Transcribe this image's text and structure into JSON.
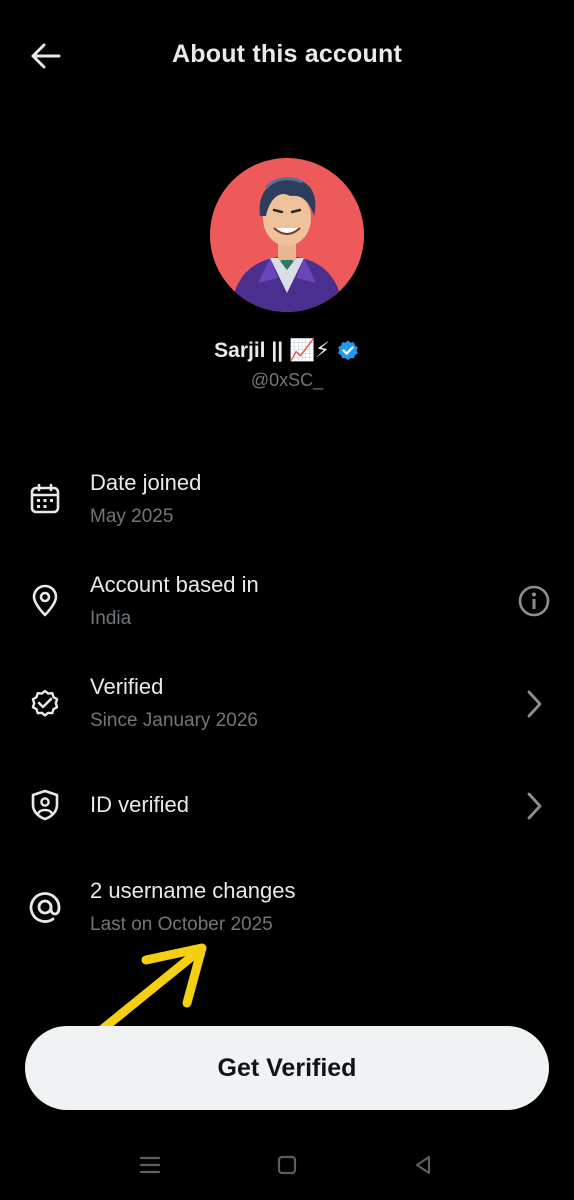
{
  "header": {
    "title": "About this account",
    "back_icon": "arrow-left-icon"
  },
  "profile": {
    "display_name": "Sarjil || 📈⚡",
    "handle": "@0xSC_",
    "verified_badge_color": "#1d9bf0",
    "avatar_bg": "#ee5a5a"
  },
  "rows": [
    {
      "icon": "calendar-icon",
      "title": "Date joined",
      "subtitle": "May 2025",
      "action": ""
    },
    {
      "icon": "location-pin-icon",
      "title": "Account based in",
      "subtitle": "India",
      "action": "info-icon"
    },
    {
      "icon": "verified-badge-icon",
      "title": "Verified",
      "subtitle": "Since January 2026",
      "action": "chevron-right-icon"
    },
    {
      "icon": "id-shield-icon",
      "title": "ID verified",
      "subtitle": "",
      "action": "chevron-right-icon"
    },
    {
      "icon": "at-sign-icon",
      "title": "2 username changes",
      "subtitle": "Last on October 2025",
      "action": ""
    }
  ],
  "cta": {
    "label": "Get Verified"
  },
  "annotation": {
    "arrow_color": "#f5cf12"
  },
  "navbar": {
    "items": [
      "menu-icon",
      "home-square-icon",
      "back-triangle-icon"
    ]
  },
  "colors": {
    "background": "#000000",
    "primary_text": "#e7e9ea",
    "secondary_text": "#71767b",
    "button_bg": "#eff3f4",
    "button_text": "#0f1419"
  }
}
